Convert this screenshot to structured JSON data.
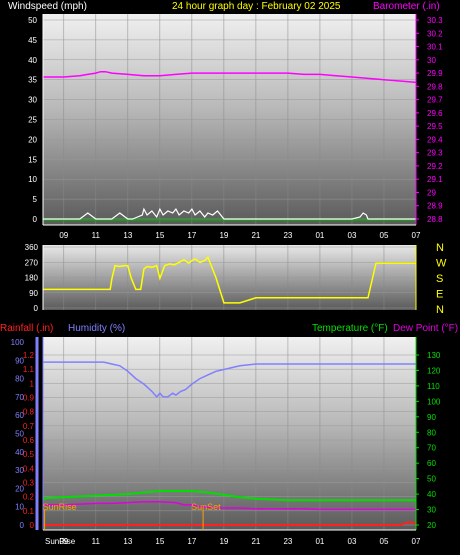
{
  "colors": {
    "wind": "#ffffff",
    "pressure": "#ff00ff",
    "direction": "#ffff00",
    "rain": "#ff2020",
    "humidity": "#8080ff",
    "temperature": "#00e000",
    "dewpoint": "#e000e0",
    "title": "#ffff00",
    "axis_white": "#ffffff",
    "sun": "#ffa000"
  },
  "time_ticks": [
    "09",
    "11",
    "13",
    "15",
    "17",
    "19",
    "21",
    "23",
    "01",
    "03",
    "05",
    "07"
  ],
  "chart_data": [
    {
      "type": "line",
      "title": "24 hour graph day : February 02 2025",
      "x_hours": [
        7.7,
        9,
        10,
        11,
        12,
        13,
        14,
        15,
        16,
        17,
        18,
        19,
        20,
        21,
        22,
        23,
        24,
        25,
        26,
        27,
        28,
        29,
        30,
        31
      ],
      "y_left": {
        "label": "Windspeed (mph)",
        "ticks": [
          "0",
          "5",
          "10",
          "15",
          "20",
          "25",
          "30",
          "35",
          "40",
          "45",
          "50"
        ],
        "range": [
          0,
          50
        ]
      },
      "y_right": {
        "label": "Barometer (.in)",
        "ticks": [
          "28.8",
          "28.9",
          "29",
          "29.1",
          "29.2",
          "29.3",
          "29.4",
          "29.5",
          "29.6",
          "29.7",
          "29.8",
          "29.9",
          "30",
          "30.1",
          "30.2",
          "30.3"
        ],
        "range": [
          28.8,
          30.3
        ]
      },
      "series": [
        {
          "name": "Windspeed (mph)",
          "axis": "left",
          "x": [
            7.7,
            8,
            9,
            10,
            10.5,
            11,
            11.5,
            12,
            12.5,
            13,
            13.3,
            13.6,
            13.9,
            14,
            14.2,
            14.5,
            14.8,
            15,
            15.2,
            15.5,
            15.8,
            16,
            16.2,
            16.5,
            16.8,
            17,
            17.2,
            17.5,
            17.8,
            18,
            18.3,
            18.6,
            19,
            20,
            21,
            22,
            23,
            24,
            25,
            26,
            27,
            27.5,
            27.7,
            27.9,
            28,
            29,
            30,
            31
          ],
          "values": [
            0,
            0,
            0,
            0,
            1.5,
            0,
            0,
            0,
            1.5,
            0,
            0,
            0.5,
            1,
            2.5,
            1,
            2,
            0.5,
            2.5,
            1,
            2,
            1.5,
            2.5,
            1,
            2,
            1.5,
            2.5,
            1,
            2,
            0.5,
            1.5,
            1,
            2,
            0,
            0,
            0,
            0,
            0,
            0,
            0,
            0,
            0,
            0.5,
            1.5,
            1,
            0,
            0,
            0,
            0
          ]
        },
        {
          "name": "Barometer (.in)",
          "axis": "right",
          "x": [
            7.7,
            8,
            9,
            10,
            10.5,
            11,
            11.3,
            11.6,
            12,
            13,
            14,
            15,
            16,
            17,
            18,
            19,
            20,
            21,
            22,
            23,
            24,
            25,
            26,
            27,
            28,
            29,
            30,
            31
          ],
          "values": [
            29.87,
            29.87,
            29.87,
            29.88,
            29.89,
            29.9,
            29.91,
            29.91,
            29.9,
            29.89,
            29.88,
            29.88,
            29.89,
            29.9,
            29.9,
            29.9,
            29.9,
            29.9,
            29.9,
            29.9,
            29.89,
            29.89,
            29.88,
            29.87,
            29.86,
            29.85,
            29.84,
            29.83
          ]
        }
      ]
    },
    {
      "type": "line",
      "title": "",
      "y_left": {
        "ticks": [
          "0",
          "90",
          "180",
          "270",
          "360"
        ],
        "range": [
          0,
          360
        ]
      },
      "y_right": {
        "ticks": [
          "N",
          "W",
          "S",
          "E",
          "N"
        ]
      },
      "series": [
        {
          "name": "Wind direction",
          "x": [
            7.7,
            8,
            9,
            10,
            11,
            11.9,
            12,
            12.2,
            12.5,
            12.8,
            13,
            13.2,
            13.5,
            13.8,
            14,
            14.2,
            14.5,
            14.8,
            15,
            15.3,
            15.6,
            15.9,
            16.2,
            16.5,
            16.8,
            17,
            17.2,
            17.5,
            17.8,
            18,
            18.5,
            19,
            20,
            21,
            22,
            23,
            24,
            25,
            26,
            27,
            27.8,
            28,
            28.5,
            29,
            30,
            31
          ],
          "values": [
            110,
            110,
            110,
            110,
            110,
            110,
            170,
            250,
            245,
            250,
            250,
            180,
            110,
            110,
            230,
            245,
            240,
            250,
            175,
            250,
            260,
            255,
            270,
            285,
            265,
            280,
            290,
            270,
            280,
            300,
            180,
            30,
            30,
            60,
            60,
            60,
            60,
            60,
            60,
            60,
            60,
            60,
            265,
            265,
            265,
            265
          ]
        }
      ]
    },
    {
      "type": "line",
      "title": "",
      "x_hours_labels": [
        "SunRise",
        "09",
        "11",
        "13",
        "15",
        "17",
        "19",
        "21",
        "23",
        "01",
        "03",
        "05",
        "07"
      ],
      "y_left": {
        "label": "Humidity (%)",
        "ticks": [
          "0",
          "10",
          "20",
          "30",
          "40",
          "50",
          "60",
          "70",
          "80",
          "90",
          "100"
        ],
        "range": [
          0,
          100
        ]
      },
      "y_rain": {
        "label": "Rainfall (.in)",
        "ticks": [
          "0",
          "0.1",
          "0.2",
          "0.3",
          "0.4",
          "0.5",
          "0.6",
          "0.7",
          "0.8",
          "0.9",
          "1",
          "1.1",
          "1.2"
        ],
        "range": [
          0,
          1.2
        ]
      },
      "y_right": {
        "label": "Temperature (°F)",
        "label2": "Dew Point (°F)",
        "ticks": [
          "20",
          "30",
          "40",
          "50",
          "60",
          "70",
          "80",
          "90",
          "100",
          "110",
          "120",
          "130"
        ],
        "range": [
          20,
          130
        ]
      },
      "annotations": [
        {
          "text": "SunRise",
          "x": 7.8
        },
        {
          "text": "SunSet",
          "x": 17.7
        }
      ],
      "series": [
        {
          "name": "Rainfall (.in)",
          "axis": "rain",
          "x": [
            7.7,
            8,
            10,
            12,
            14,
            16,
            18,
            20,
            22,
            24,
            26,
            28,
            30,
            30.3,
            30.6,
            31
          ],
          "values": [
            0,
            0,
            0,
            0,
            0,
            0,
            0,
            0,
            0,
            0,
            0,
            0,
            0,
            0.01,
            0.02,
            0.01
          ]
        },
        {
          "name": "Humidity (%)",
          "axis": "left",
          "x": [
            7.7,
            8,
            9,
            10,
            11,
            11.5,
            12,
            12.5,
            13,
            13.5,
            14,
            14.5,
            14.8,
            15,
            15.2,
            15.5,
            15.8,
            16,
            16.3,
            16.6,
            17,
            17.5,
            18,
            18.5,
            19,
            19.5,
            20,
            21,
            22,
            23,
            24,
            25,
            26,
            27,
            28,
            29,
            30,
            31
          ],
          "values": [
            89,
            89,
            89,
            89,
            89,
            89,
            88,
            87,
            84,
            80,
            77,
            73,
            70,
            72,
            70,
            70,
            72,
            71,
            73,
            74,
            77,
            80,
            82,
            84,
            85,
            86,
            87,
            88,
            88,
            88,
            88,
            88,
            88,
            88,
            88,
            88,
            88,
            88
          ]
        },
        {
          "name": "Temperature (°F)",
          "axis": "right",
          "x": [
            7.7,
            8,
            9,
            10,
            11,
            12,
            13,
            14,
            15,
            16,
            17,
            17.5,
            18,
            19,
            20,
            21,
            22,
            23,
            24,
            25,
            26,
            27,
            28,
            29,
            30,
            31
          ],
          "values": [
            37,
            37.5,
            38,
            38.5,
            39,
            39.5,
            40,
            41,
            42,
            42,
            42,
            41.5,
            41,
            39.5,
            38,
            37,
            36.5,
            36,
            36,
            36,
            36,
            36,
            36,
            36,
            36,
            36
          ]
        },
        {
          "name": "Dew Point (°F)",
          "axis": "right",
          "x": [
            7.7,
            8,
            9,
            10,
            11,
            12,
            13,
            14,
            15,
            16,
            16.5,
            17,
            17.5,
            18,
            19,
            20,
            21,
            22,
            23,
            24,
            25,
            26,
            27,
            28,
            29,
            30,
            31
          ],
          "values": [
            33,
            33,
            33,
            33.5,
            34,
            34,
            34.5,
            35,
            35,
            34.5,
            33,
            33,
            32,
            31.5,
            31,
            31,
            30.5,
            30.5,
            30.5,
            30.5,
            30,
            30,
            30,
            30,
            30,
            30,
            30
          ]
        }
      ]
    }
  ]
}
